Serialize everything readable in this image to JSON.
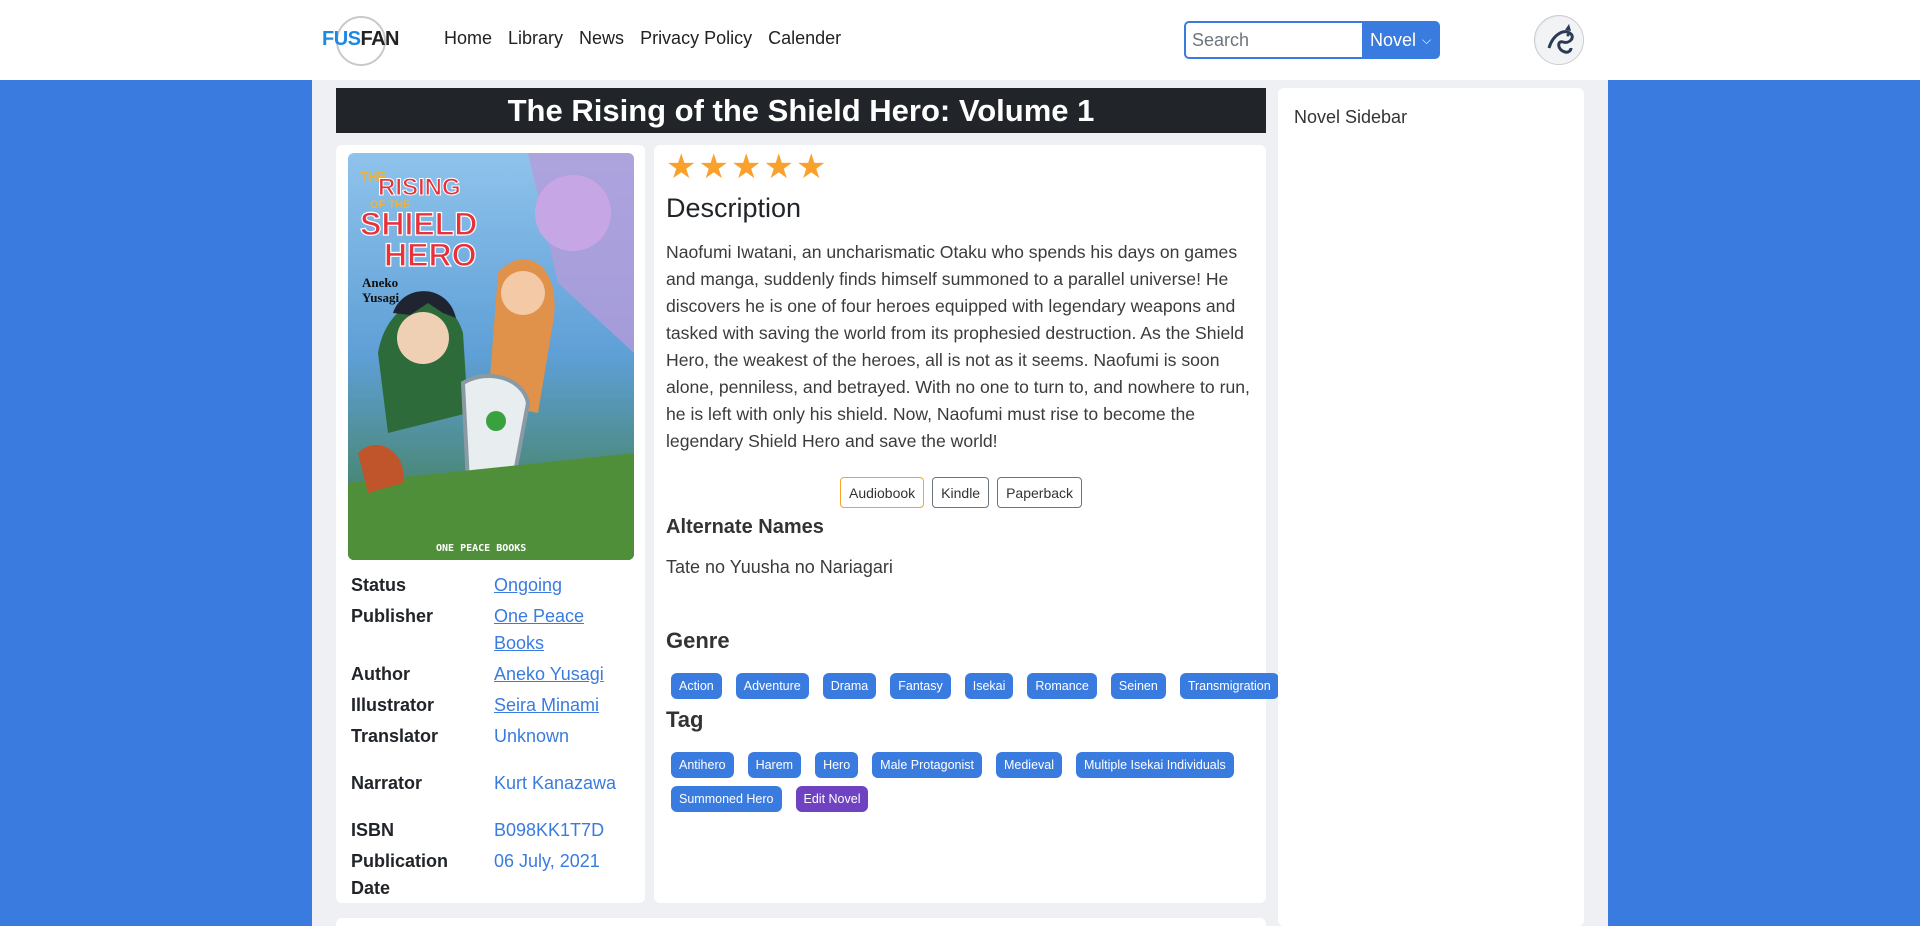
{
  "header": {
    "logo_text_a": "FUS",
    "logo_text_b": "FAN",
    "nav": [
      "Home",
      "Library",
      "News",
      "Privacy Policy",
      "Calender"
    ],
    "search_placeholder": "Search",
    "search_type": "Novel"
  },
  "novel": {
    "title": "The Rising of the Shield Hero: Volume 1",
    "rating_stars": 5,
    "description_heading": "Description",
    "description": "Naofumi Iwatani, an uncharismatic Otaku who spends his days on games and manga, suddenly finds himself summoned to a parallel universe! He discovers he is one of four heroes equipped with legendary weapons and tasked with saving the world from its prophesied destruction. As the Shield Hero, the weakest of the heroes, all is not as it seems. Naofumi is soon alone, penniless, and betrayed. With no one to turn to, and nowhere to run, he is left with only his shield. Now, Naofumi must rise to become the legendary Shield Hero and save the world!",
    "formats": [
      "Audiobook",
      "Kindle",
      "Paperback"
    ],
    "alt_heading": "Alternate Names",
    "alt_name": "Tate no Yuusha no Nariagari",
    "genre_heading": "Genre",
    "genres": [
      "Action",
      "Adventure",
      "Drama",
      "Fantasy",
      "Isekai",
      "Romance",
      "Seinen",
      "Transmigration"
    ],
    "tag_heading": "Tag",
    "tags_row1": [
      "Antihero",
      "Harem",
      "Hero",
      "Male Protagonist",
      "Medieval",
      "Multiple Isekai Individuals"
    ],
    "tags_row2": [
      "Summoned Hero"
    ],
    "edit_label": "Edit Novel",
    "cover": {
      "title_line1": "THE",
      "title_line2": "RISING",
      "title_line3": "OF THE",
      "title_line4": "SHIELD",
      "title_line5": "HERO",
      "author_line1": "Aneko",
      "author_line2": "Yusagi",
      "publisher": "ONE PEACE BOOKS"
    }
  },
  "info": {
    "status_label": "Status",
    "status": "Ongoing",
    "publisher_label": "Publisher",
    "publisher_1": "One Peace",
    "publisher_2": "Books",
    "author_label": "Author",
    "author": "Aneko Yusagi",
    "illustrator_label": "Illustrator",
    "illustrator": "Seira Minami",
    "translator_label": "Translator",
    "translator": "Unknown",
    "narrator_label": "Narrator",
    "narrator": "Kurt Kanazawa",
    "isbn_label": "ISBN",
    "isbn": "B098KK1T7D",
    "pubdate_label_1": "Publication",
    "pubdate_label_2": "Date",
    "pubdate": "06 July, 2021"
  },
  "sidebar": {
    "title": "Novel Sidebar"
  },
  "colors": {
    "brand": "#3a7bdf",
    "star": "#f9a12b",
    "edit": "#6f42c1",
    "title_bar": "#212529"
  }
}
